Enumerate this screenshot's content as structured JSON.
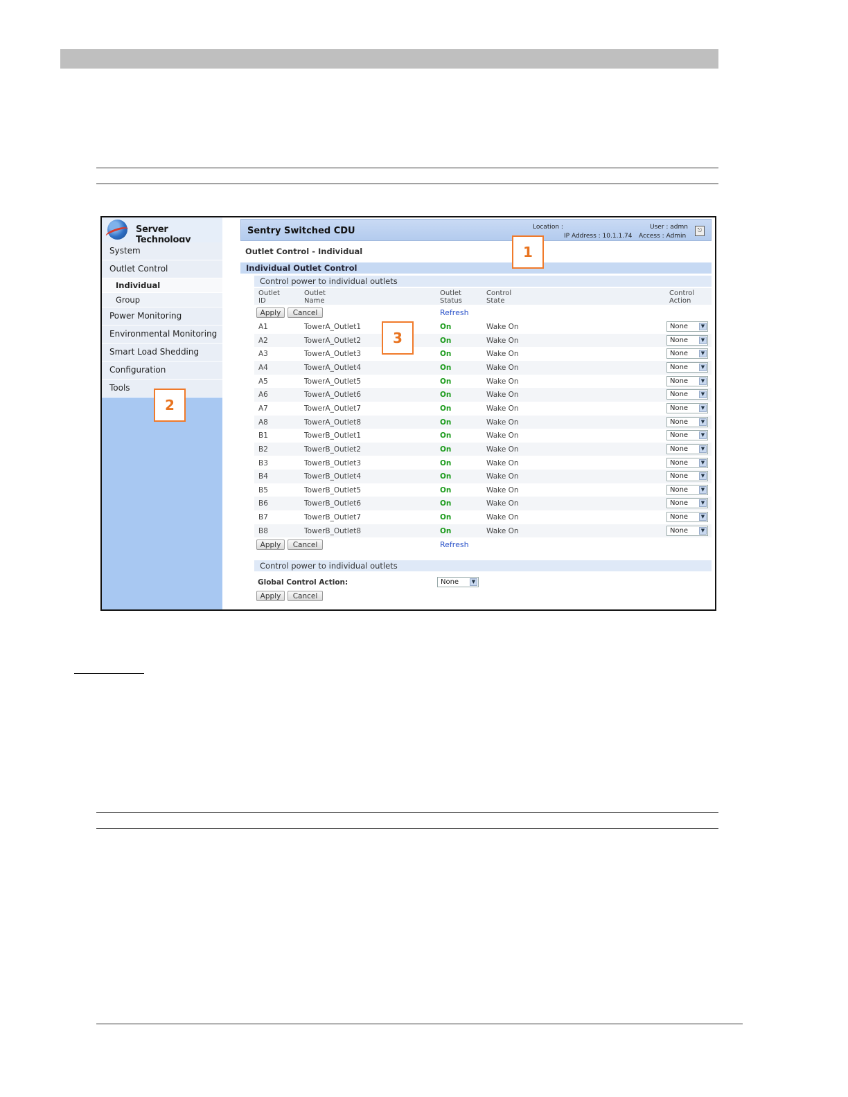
{
  "app": {
    "brand": "Server Technology",
    "title": "Sentry Switched CDU",
    "location_label": "Location :",
    "ip_label": "IP Address : 10.1.1.74",
    "user_label": "User : admn",
    "access_label": "Access : Admin",
    "logout_icon": "logout-icon"
  },
  "sidebar": {
    "items": [
      {
        "label": "System"
      },
      {
        "label": "Outlet Control"
      },
      {
        "label": "Individual"
      },
      {
        "label": "Group"
      },
      {
        "label": "Power Monitoring"
      },
      {
        "label": "Environmental Monitoring"
      },
      {
        "label": "Smart Load Shedding"
      },
      {
        "label": "Configuration"
      },
      {
        "label": "Tools"
      }
    ]
  },
  "main": {
    "page_title": "Outlet Control - Individual",
    "section_title": "Individual Outlet Control",
    "subsection_title": "Control power to individual outlets",
    "columns": {
      "id": "Outlet\nID",
      "name": "Outlet\nName",
      "status": "Outlet\nStatus",
      "state": "Control\nState",
      "action": "Control\nAction"
    },
    "apply_label": "Apply",
    "cancel_label": "Cancel",
    "refresh_label": "Refresh",
    "outlets": [
      {
        "id": "A1",
        "name": "TowerA_Outlet1",
        "status": "On",
        "state": "Wake On",
        "action": "None"
      },
      {
        "id": "A2",
        "name": "TowerA_Outlet2",
        "status": "On",
        "state": "Wake On",
        "action": "None"
      },
      {
        "id": "A3",
        "name": "TowerA_Outlet3",
        "status": "On",
        "state": "Wake On",
        "action": "None"
      },
      {
        "id": "A4",
        "name": "TowerA_Outlet4",
        "status": "On",
        "state": "Wake On",
        "action": "None"
      },
      {
        "id": "A5",
        "name": "TowerA_Outlet5",
        "status": "On",
        "state": "Wake On",
        "action": "None"
      },
      {
        "id": "A6",
        "name": "TowerA_Outlet6",
        "status": "On",
        "state": "Wake On",
        "action": "None"
      },
      {
        "id": "A7",
        "name": "TowerA_Outlet7",
        "status": "On",
        "state": "Wake On",
        "action": "None"
      },
      {
        "id": "A8",
        "name": "TowerA_Outlet8",
        "status": "On",
        "state": "Wake On",
        "action": "None"
      },
      {
        "id": "B1",
        "name": "TowerB_Outlet1",
        "status": "On",
        "state": "Wake On",
        "action": "None"
      },
      {
        "id": "B2",
        "name": "TowerB_Outlet2",
        "status": "On",
        "state": "Wake On",
        "action": "None"
      },
      {
        "id": "B3",
        "name": "TowerB_Outlet3",
        "status": "On",
        "state": "Wake On",
        "action": "None"
      },
      {
        "id": "B4",
        "name": "TowerB_Outlet4",
        "status": "On",
        "state": "Wake On",
        "action": "None"
      },
      {
        "id": "B5",
        "name": "TowerB_Outlet5",
        "status": "On",
        "state": "Wake On",
        "action": "None"
      },
      {
        "id": "B6",
        "name": "TowerB_Outlet6",
        "status": "On",
        "state": "Wake On",
        "action": "None"
      },
      {
        "id": "B7",
        "name": "TowerB_Outlet7",
        "status": "On",
        "state": "Wake On",
        "action": "None"
      },
      {
        "id": "B8",
        "name": "TowerB_Outlet8",
        "status": "On",
        "state": "Wake On",
        "action": "None"
      }
    ],
    "global_section_title": "Control power to individual outlets",
    "global_label": "Global Control Action:",
    "global_value": "None"
  },
  "callouts": [
    "1",
    "2",
    "3"
  ],
  "colors": {
    "status_on": "#1a9a1a",
    "refresh_link": "#2a52c9",
    "callout": "#f07a2a",
    "sidebar": "#a8c8f2"
  }
}
